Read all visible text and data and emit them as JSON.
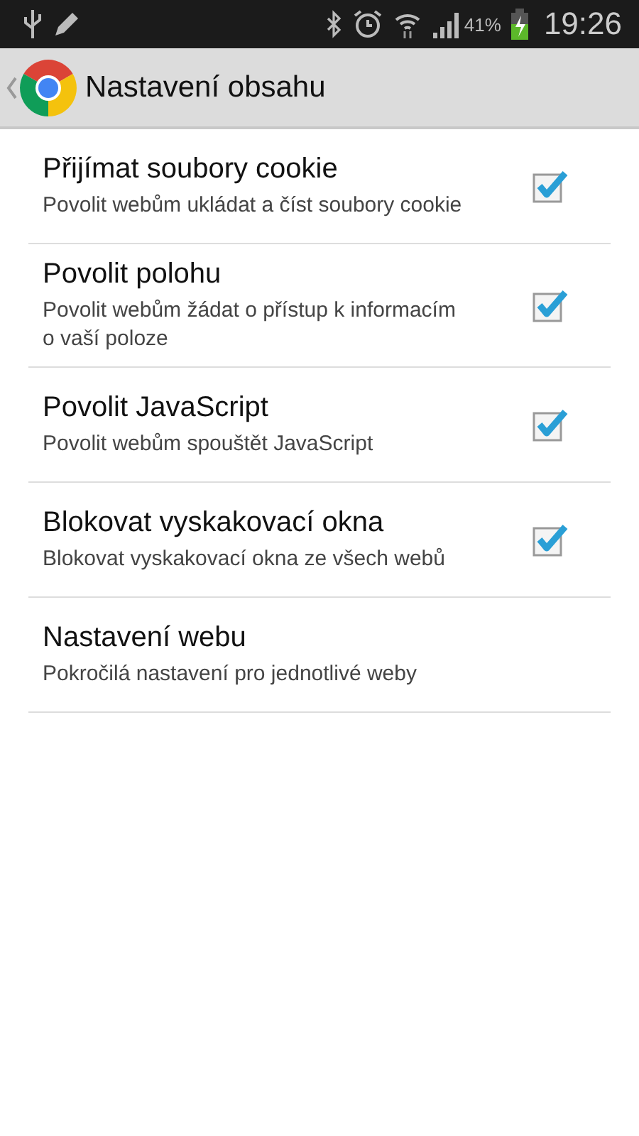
{
  "status_bar": {
    "battery_percent": "41%",
    "time": "19:26"
  },
  "action_bar": {
    "title": "Nastavení obsahu"
  },
  "settings": [
    {
      "kind": "checkbox",
      "title": "Přijímat soubory cookie",
      "summary": "Povolit webům ukládat a číst soubory cookie",
      "checked": true
    },
    {
      "kind": "checkbox",
      "title": "Povolit polohu",
      "summary": "Povolit webům žádat o přístup k informacím o vaší poloze",
      "checked": true
    },
    {
      "kind": "checkbox",
      "title": "Povolit JavaScript",
      "summary": "Povolit webům spouštět JavaScript",
      "checked": true
    },
    {
      "kind": "checkbox",
      "title": "Blokovat vyskakovací okna",
      "summary": "Blokovat vyskakovací okna ze všech webů",
      "checked": true
    },
    {
      "kind": "link",
      "title": "Nastavení webu",
      "summary": "Pokročilá nastavení pro jednotlivé weby"
    }
  ]
}
